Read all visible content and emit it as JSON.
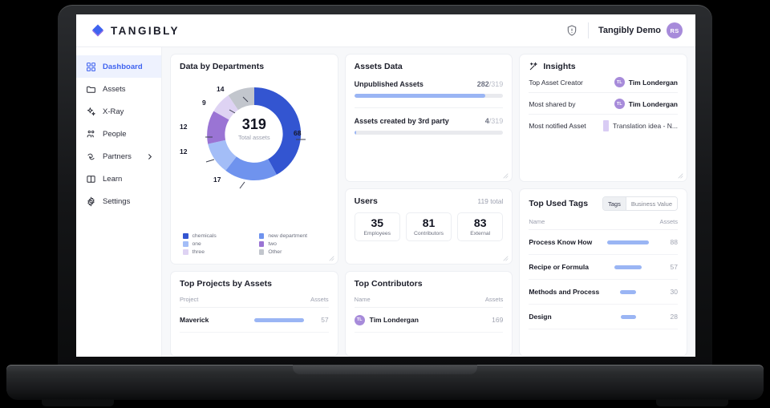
{
  "header": {
    "brand": "TANGIBLY",
    "brand_logo_icon": "diamond-logo-icon",
    "help_icon": "shield-info-icon",
    "username": "Tangibly Demo",
    "avatar_initials": "RS"
  },
  "sidebar": {
    "items": [
      {
        "label": "Dashboard",
        "icon": "grid-dashboard-icon",
        "active": true
      },
      {
        "label": "Assets",
        "icon": "folder-icon",
        "active": false
      },
      {
        "label": "X-Ray",
        "icon": "sparkle-xray-icon",
        "active": false
      },
      {
        "label": "People",
        "icon": "people-icon",
        "active": false
      },
      {
        "label": "Partners",
        "icon": "handshake-icon",
        "active": false,
        "chevron": true
      },
      {
        "label": "Learn",
        "icon": "book-icon",
        "active": false
      },
      {
        "label": "Settings",
        "icon": "gear-icon",
        "active": false
      }
    ]
  },
  "departments": {
    "title": "Data by Departments",
    "center_value": "319",
    "center_label": "Total assets",
    "legend": [
      {
        "label": "chemicals",
        "color": "#3355d1"
      },
      {
        "label": "new department",
        "color": "#6f93ee"
      },
      {
        "label": "one",
        "color": "#a3bdf7"
      },
      {
        "label": "two",
        "color": "#9a74d4"
      },
      {
        "label": "three",
        "color": "#ded3f3"
      },
      {
        "label": "Other",
        "color": "#c2c6cd"
      }
    ]
  },
  "assets_data": {
    "title": "Assets Data",
    "rows": [
      {
        "label": "Unpublished Assets",
        "value": "282",
        "denominator": "/319",
        "percent": 88
      },
      {
        "label": "Assets created by 3rd party",
        "value": "4",
        "denominator": "/319",
        "percent": 1.3
      }
    ]
  },
  "insights": {
    "title": "Insights",
    "icon": "magic-wand-icon",
    "rows": [
      {
        "key": "Top Asset Creator",
        "value": "Tim Londergan",
        "avatar": "TL",
        "type": "user"
      },
      {
        "key": "Most shared by",
        "value": "Tim Londergan",
        "avatar": "TL",
        "type": "user"
      },
      {
        "key": "Most notified Asset",
        "value": "Translation idea - N...",
        "type": "doc"
      }
    ]
  },
  "users": {
    "title": "Users",
    "total": "119 total",
    "stats": [
      {
        "number": "35",
        "label": "Employees"
      },
      {
        "number": "81",
        "label": "Contributors"
      },
      {
        "number": "83",
        "label": "External"
      }
    ]
  },
  "top_used_tags": {
    "title": "Top Used Tags",
    "toggle": [
      {
        "label": "Tags",
        "active": true
      },
      {
        "label": "Business Value",
        "active": false
      }
    ],
    "col_name": "Name",
    "col_assets": "Assets",
    "rows": [
      {
        "name": "Process Know How",
        "value": "88",
        "percent": 100
      },
      {
        "name": "Recipe or Formula",
        "value": "57",
        "percent": 65
      },
      {
        "name": "Methods and Process",
        "value": "30",
        "percent": 34
      },
      {
        "name": "Design",
        "value": "28",
        "percent": 32
      }
    ]
  },
  "top_projects": {
    "title": "Top Projects by Assets",
    "col_name": "Project",
    "col_assets": "Assets",
    "rows": [
      {
        "name": "Maverick",
        "value": "57",
        "percent": 100
      }
    ]
  },
  "top_contributors": {
    "title": "Top Contributors",
    "col_name": "Name",
    "col_assets": "Assets",
    "rows": [
      {
        "name": "Tim Londergan",
        "avatar": "TL",
        "value": "169"
      }
    ]
  },
  "chart_data": {
    "type": "pie",
    "title": "Data by Departments",
    "categories": [
      "chemicals",
      "new department",
      "one",
      "two",
      "three",
      "Other"
    ],
    "values": [
      68,
      17,
      12,
      12,
      9,
      14
    ],
    "colors": [
      "#3355d1",
      "#6f93ee",
      "#a3bdf7",
      "#9a74d4",
      "#ded3f3",
      "#c2c6cd"
    ],
    "total": 319,
    "center_label": "Total assets",
    "legend_position": "bottom",
    "donut": true,
    "labels_shown": [
      "68",
      "17",
      "12",
      "12",
      "9",
      "14"
    ]
  }
}
